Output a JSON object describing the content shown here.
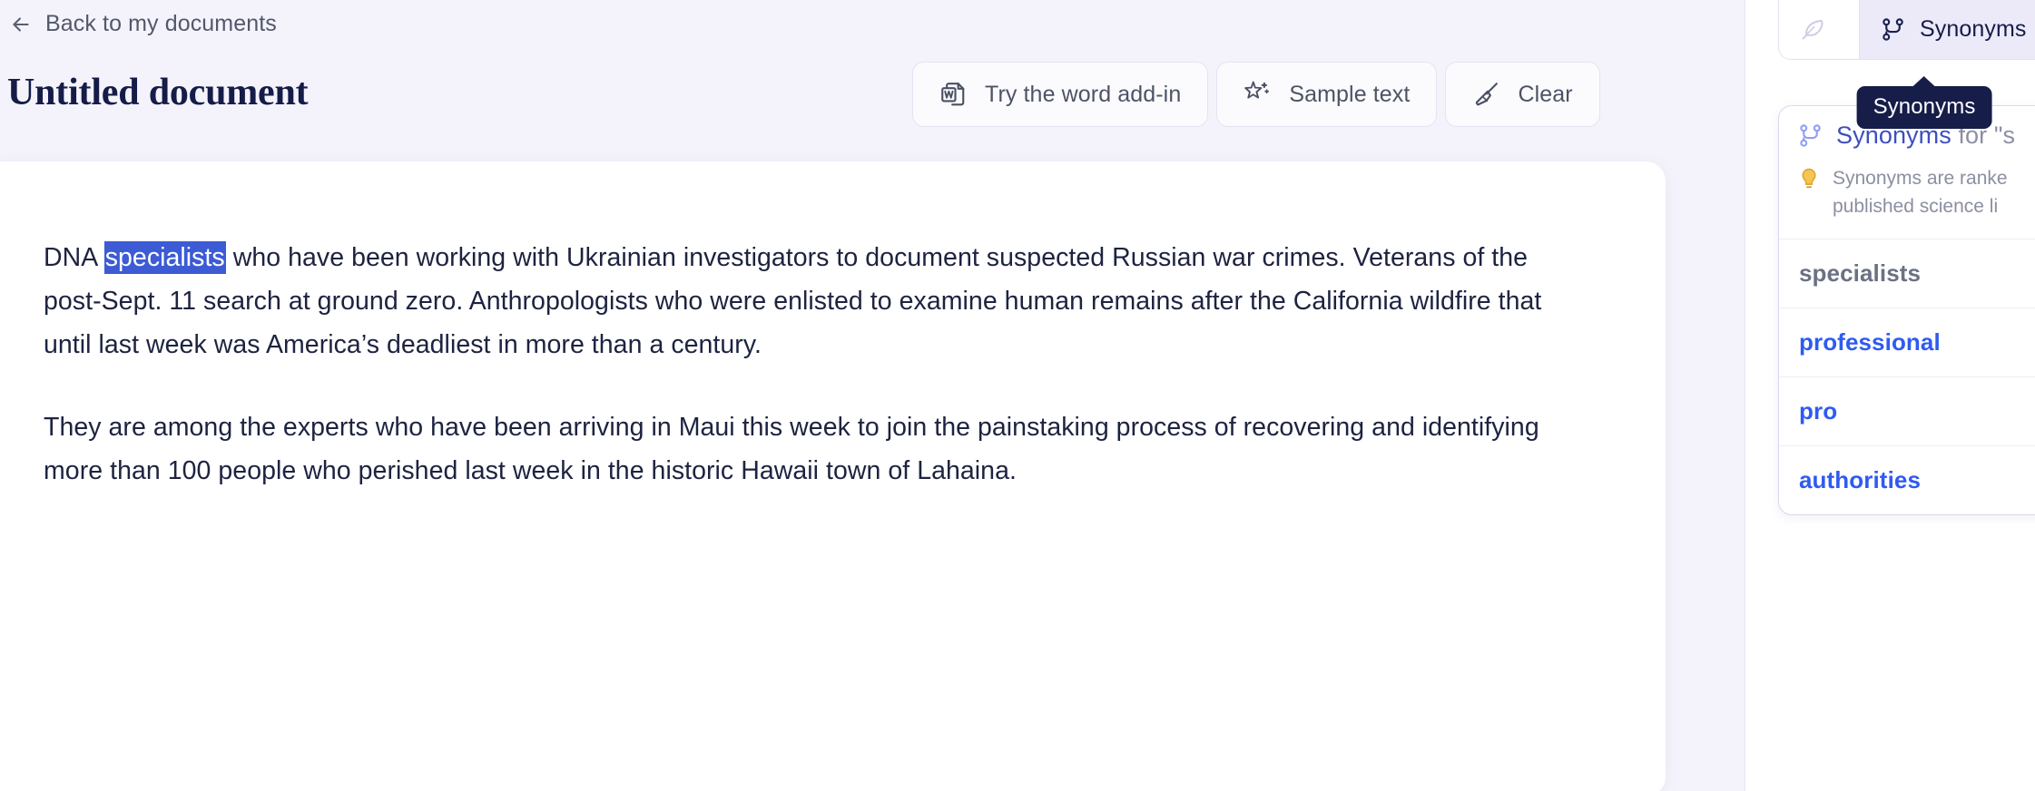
{
  "header": {
    "back_label": "Back to my documents",
    "back_icon": "arrow-left-icon",
    "doc_title": "Untitled document"
  },
  "toolbar": {
    "buttons": [
      {
        "label": "Try the word add-in",
        "icon": "word-document-icon"
      },
      {
        "label": "Sample text",
        "icon": "sparkle-star-icon"
      },
      {
        "label": "Clear",
        "icon": "broom-icon"
      }
    ]
  },
  "document": {
    "paragraphs": [
      {
        "before": "DNA ",
        "selected": "specialists",
        "after": " who have been working with Ukrainian investigators to document suspected Russian war crimes. Veterans of the post-Sept. 11 search at ground zero. Anthropologists who were enlisted to examine human remains after the California wildfire that until last week was America’s deadliest in more than a century."
      },
      {
        "text": "They are among the experts who have been arriving in Maui this week to join the painstaking process of recovering and identifying more than 100 people who perished last week in the historic Hawaii town of Lahaina."
      }
    ]
  },
  "right_panel": {
    "tabs": [
      {
        "label": "",
        "icon": "feather-icon",
        "active": false
      },
      {
        "label": "Synonyms",
        "icon": "git-fork-icon",
        "active": true
      }
    ],
    "tooltip": "Synonyms",
    "card": {
      "heading_strong": "Synonyms",
      "heading_rest": " for \"s",
      "heading_icon": "git-fork-icon",
      "hint_icon": "lightbulb-icon",
      "hint_text": "Synonyms are ranke\npublished science li",
      "items": [
        {
          "label": "specialists",
          "state": "current"
        },
        {
          "label": "professional",
          "state": "alt"
        },
        {
          "label": "pro",
          "state": "alt"
        },
        {
          "label": "authorities",
          "state": "alt"
        }
      ]
    }
  },
  "colors": {
    "page_bg": "#f4f3fb",
    "title": "#151c48",
    "selection_bg": "#3c5bd4",
    "accent_link": "#2f5bf0",
    "tooltip_bg": "#161d49",
    "tab_active_bg": "#eceaf9"
  }
}
